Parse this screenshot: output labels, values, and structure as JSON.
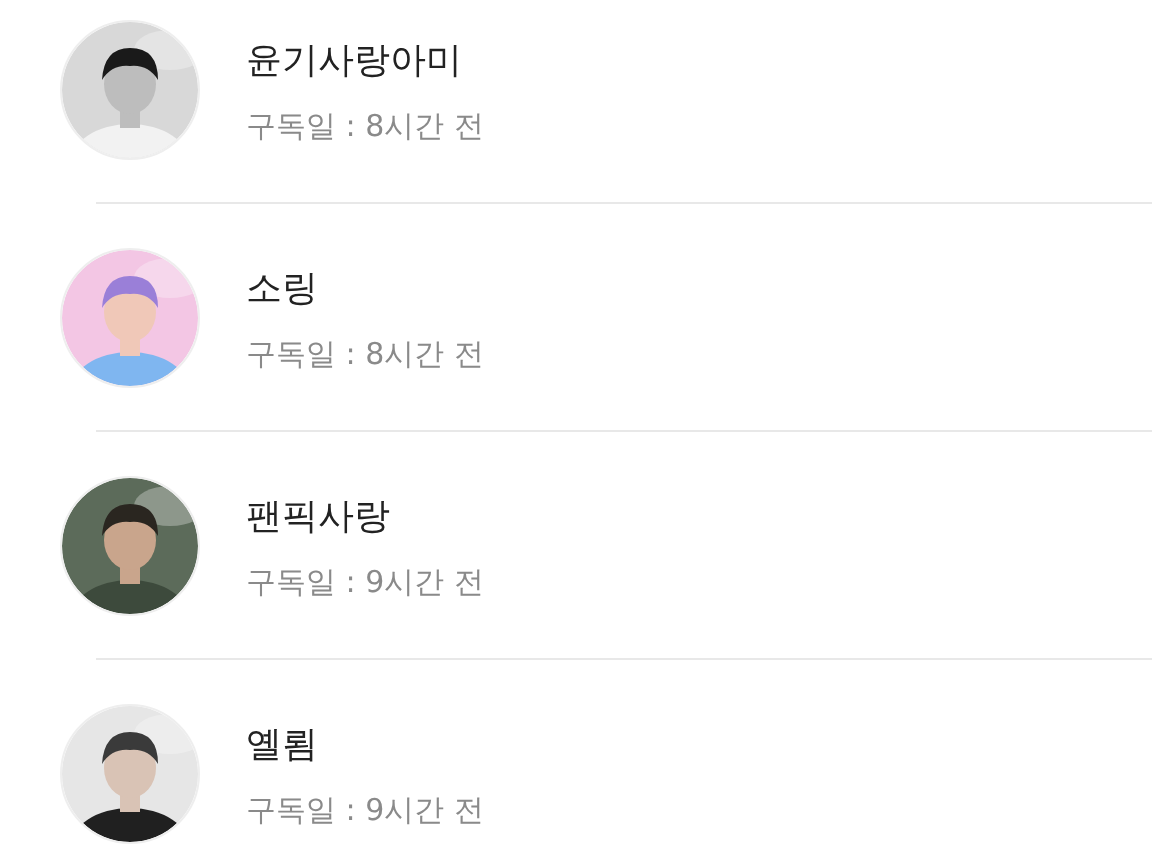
{
  "subscribers": [
    {
      "name": "윤기사랑아미",
      "subscribed": "구독일 : 8시간 전"
    },
    {
      "name": "소링",
      "subscribed": "구독일 : 8시간 전"
    },
    {
      "name": "팬픽사랑",
      "subscribed": "구독일 : 9시간 전"
    },
    {
      "name": "옐룀",
      "subscribed": "구독일 : 9시간 전"
    }
  ]
}
